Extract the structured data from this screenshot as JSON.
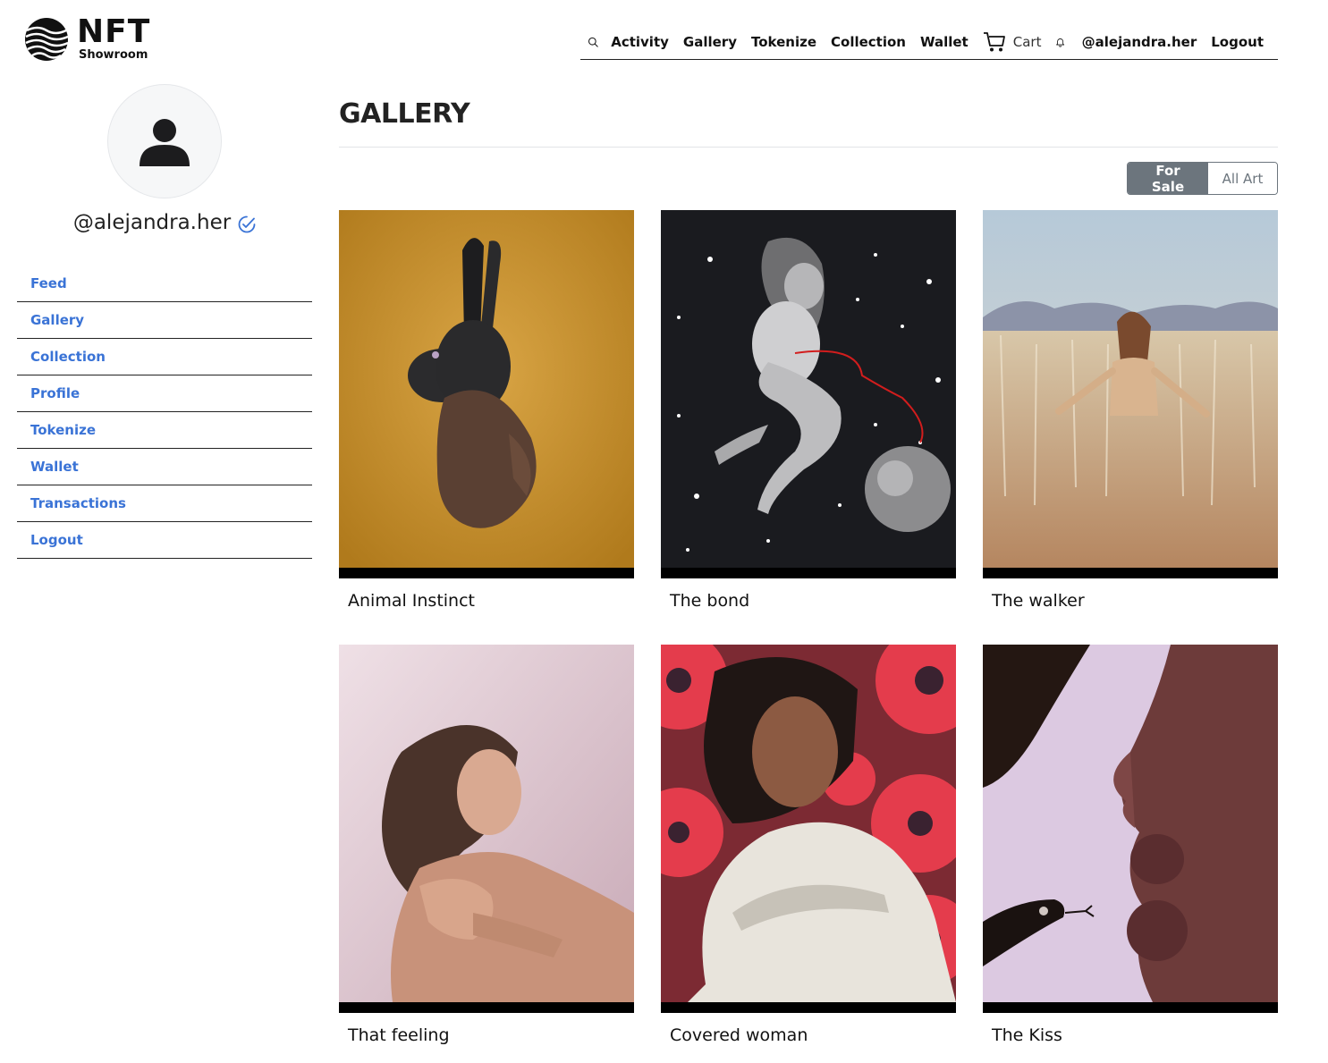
{
  "brand": {
    "name": "NFT",
    "subtitle": "Showroom"
  },
  "topnav": {
    "items": [
      "Activity",
      "Gallery",
      "Tokenize",
      "Collection",
      "Wallet"
    ],
    "cart_label": "Cart",
    "user": "@alejandra.her",
    "logout": "Logout"
  },
  "profile": {
    "username": "@alejandra.her",
    "verified": true
  },
  "sidebar": {
    "items": [
      "Feed",
      "Gallery",
      "Collection",
      "Profile",
      "Tokenize",
      "Wallet",
      "Transactions",
      "Logout"
    ]
  },
  "main": {
    "title": "GALLERY",
    "filter": {
      "options": [
        "For Sale",
        "All Art"
      ],
      "selected": "For Sale"
    }
  },
  "artworks": [
    {
      "title": "Animal Instinct"
    },
    {
      "title": "The bond"
    },
    {
      "title": "The walker"
    },
    {
      "title": "That feeling"
    },
    {
      "title": "Covered woman"
    },
    {
      "title": "The Kiss"
    }
  ],
  "colors": {
    "link": "#3a73d6",
    "toggle_active": "#6c757d",
    "text": "#111111"
  }
}
